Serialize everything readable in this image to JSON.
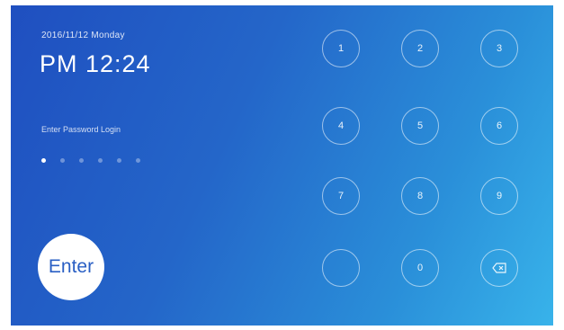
{
  "lock_screen": {
    "date": "2016/11/12 Monday",
    "time": "PM 12:24",
    "prompt": "Enter Password Login",
    "pin_filled": 1,
    "pin_length": 6,
    "enter_label": "Enter"
  },
  "keypad": {
    "keys": [
      "1",
      "2",
      "3",
      "4",
      "5",
      "6",
      "7",
      "8",
      "9",
      "",
      "0",
      ""
    ],
    "backspace_icon": "backspace-icon"
  }
}
